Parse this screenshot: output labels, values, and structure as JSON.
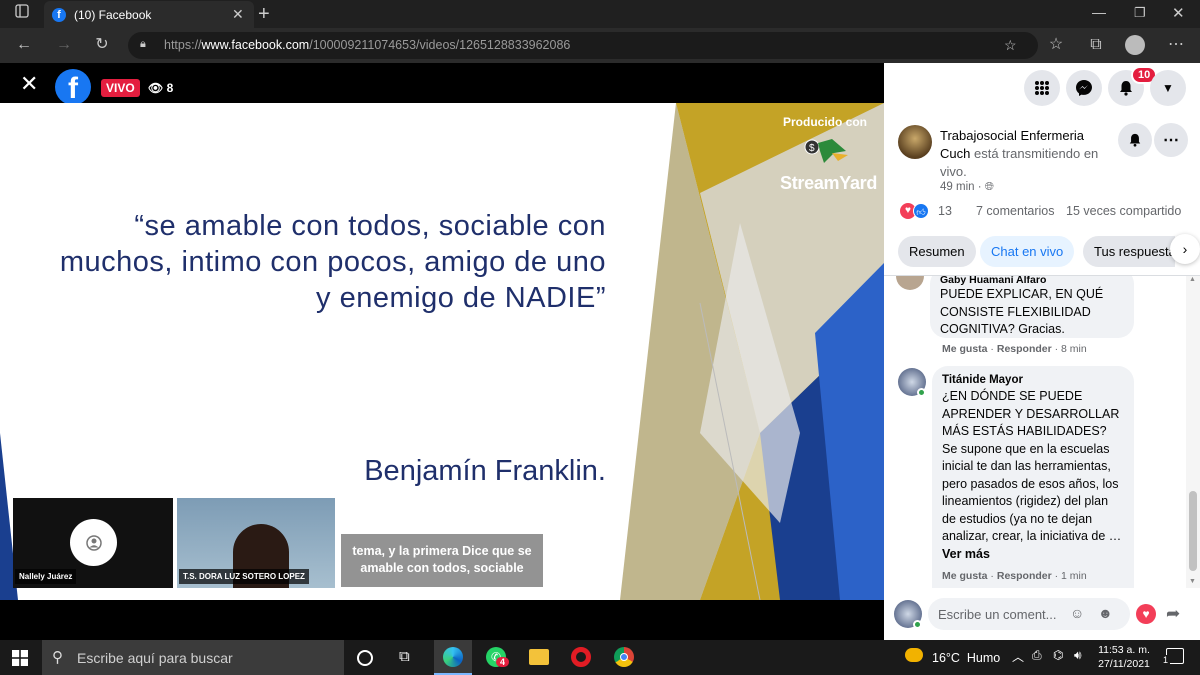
{
  "browser": {
    "tab_title": "(10) Facebook",
    "url_prefix": "https://",
    "url_host": "www.facebook.com",
    "url_path": "/100009211074653/videos/1265128833962086"
  },
  "video": {
    "live_badge": "VIVO",
    "viewers": "8",
    "slide_quote": "“se amable con todos, sociable con muchos, intimo con pocos, amigo de uno y enemigo de NADIE”",
    "slide_author": "Benjamín Franklin.",
    "produced_with": "Producido con",
    "streamyard": "StreamYard",
    "participant1": "Nallely Juárez",
    "participant2": "T.S. DORA LUZ SOTERO LOPEZ",
    "caption": "tema, y la primera Dice que se amable con todos, sociable"
  },
  "header": {
    "notif_count": "10"
  },
  "post": {
    "page_name": "Trabajosocial Enfermeria Cuch",
    "action_text": "está transmitiendo en vivo.",
    "time": "49 min ·",
    "reactions": "13",
    "comments": "7 comentarios",
    "shares": "15 veces compartido"
  },
  "tabs": [
    "Resumen",
    "Chat en vivo",
    "Tus respuesta"
  ],
  "comments": [
    {
      "author": "Gaby Huamaní Alfaro",
      "text": "PUEDE EXPLICAR, EN QUÉ CONSISTE FLEXIBILIDAD COGNITIVA? Gracias.",
      "like": "Me gusta",
      "reply": "Responder",
      "time": "8 min"
    },
    {
      "author": "Titánide Mayor",
      "text": "¿EN DÓNDE SE PUEDE APRENDER Y DESARROLLAR MÁS ESTÁS HABILIDADES? Se supone que en la escuelas inicial te dan las herramientas, pero pasados de esos años, los lineamientos (rigidez) del plan de estudios (ya no te dejan analizar, crear, la iniciativa de …",
      "more": "Ver más",
      "like": "Me gusta",
      "reply": "Responder",
      "time": "1 min"
    }
  ],
  "composer": {
    "placeholder": "Escribe un coment..."
  },
  "taskbar": {
    "search_placeholder": "Escribe aquí para buscar",
    "weather": "16°C  Humo",
    "time": "11:53 a. m.",
    "date": "27/11/2021",
    "whatsapp_badge": "4",
    "notif_count": "1"
  },
  "colors": {
    "fb_blue": "#1877f2",
    "live_red": "#e41e3f",
    "slide_text": "#1f2f6b"
  }
}
